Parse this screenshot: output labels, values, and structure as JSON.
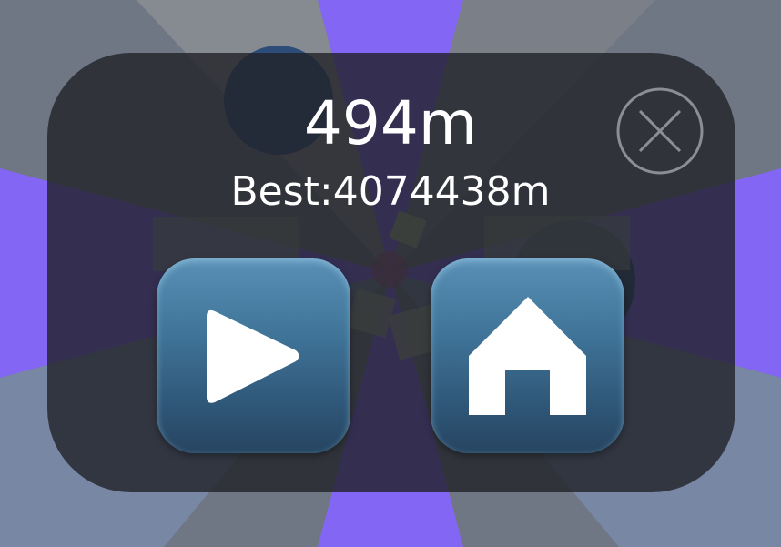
{
  "hud": {
    "distance": "494m",
    "best": "Best:4074438m"
  },
  "buttons": {
    "close_icon": "close-icon",
    "play_icon": "play-icon",
    "home_icon": "home-icon"
  },
  "colors": {
    "scene_purple": "#8367f4",
    "scene_grey": "#6f7784",
    "overlay": "#202228",
    "button_top": "#5a90b6",
    "button_bottom": "#264561"
  }
}
